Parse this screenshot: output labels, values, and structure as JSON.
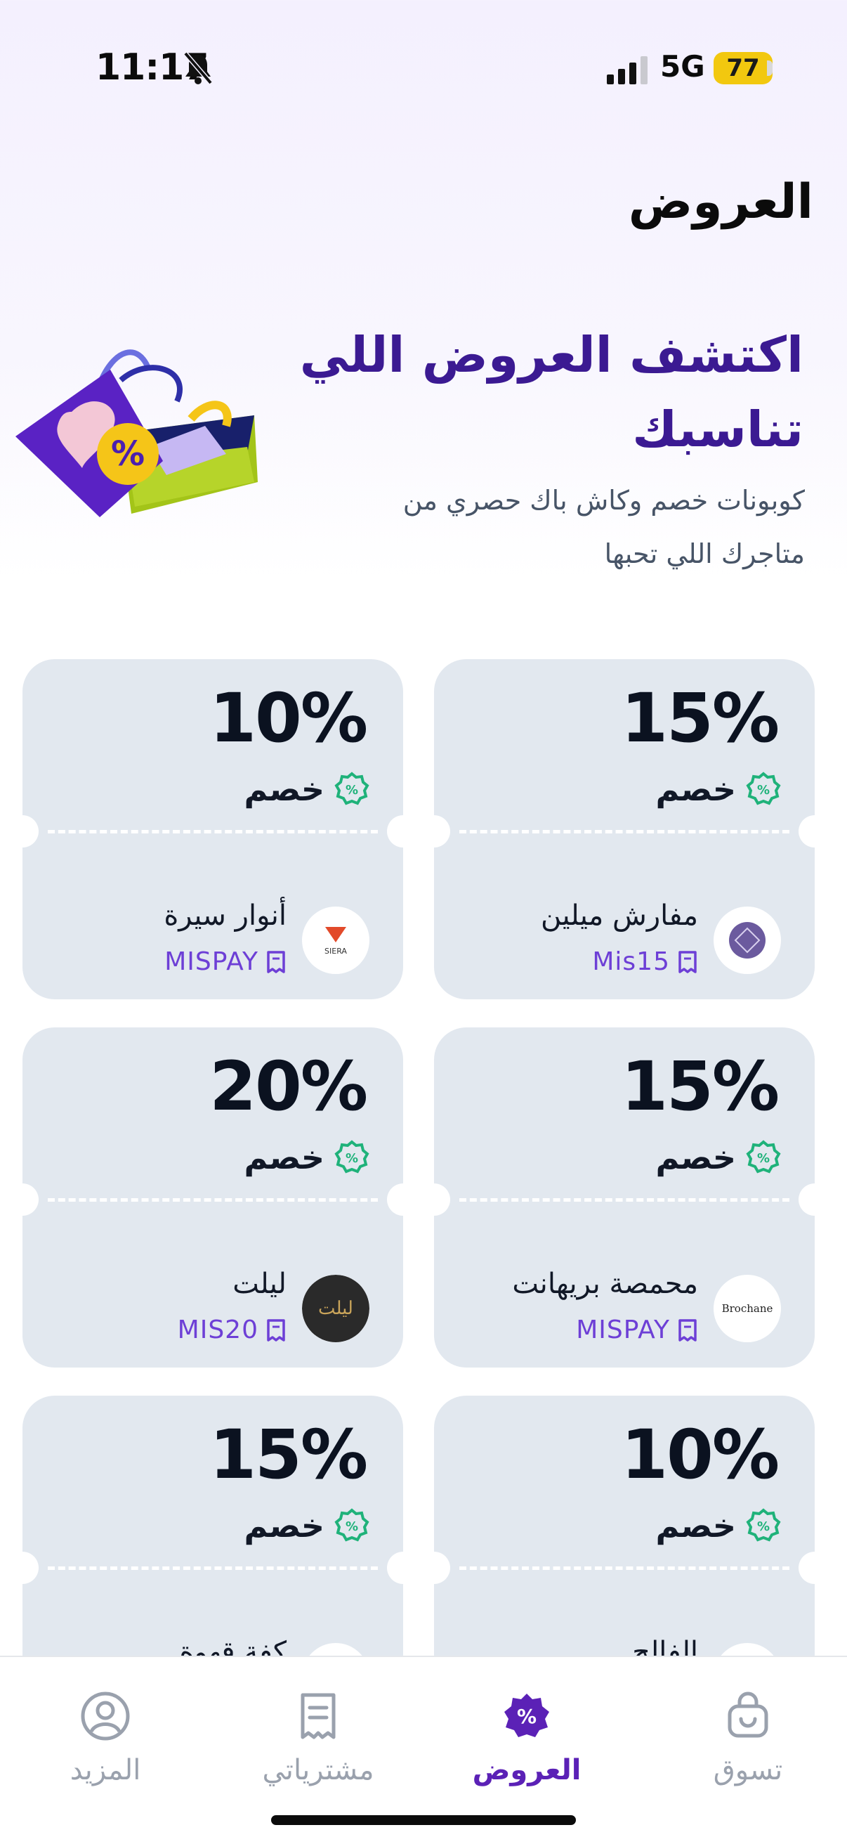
{
  "status_bar": {
    "time": "11:17",
    "network": "5G",
    "battery": "77"
  },
  "page_title": "العروض",
  "hero": {
    "heading": "اكتشف العروض اللي تناسبك",
    "subtitle": "كوبونات خصم وكاش باك حصري من متاجرك اللي تحبها"
  },
  "discount_label": "خصم",
  "offers": [
    {
      "percent": "15%",
      "merchant": "مفارش ميلين",
      "code": "Mis15",
      "logo_text": ""
    },
    {
      "percent": "10%",
      "merchant": "أنوار سيرة",
      "code": "MISPAY",
      "logo_text": "SIERA"
    },
    {
      "percent": "15%",
      "merchant": "محمصة بريهانت",
      "code": "MISPAY",
      "logo_text": "Brochane"
    },
    {
      "percent": "20%",
      "merchant": "ليلت",
      "code": "MIS20",
      "logo_text": "ليلت"
    },
    {
      "percent": "10%",
      "merchant": "الفالح",
      "code": "",
      "logo_text": ""
    },
    {
      "percent": "15%",
      "merchant": "كفة قهوة",
      "code": "",
      "logo_text": ""
    }
  ],
  "nav": {
    "shop": "تسوق",
    "offers": "العروض",
    "purchases": "مشترياتي",
    "more": "المزيد"
  },
  "colors": {
    "accent": "#5b21b6",
    "card_bg": "#e2e8ef",
    "coupon_code": "#6d3fd6",
    "discount_badge": "#1fb27a"
  }
}
